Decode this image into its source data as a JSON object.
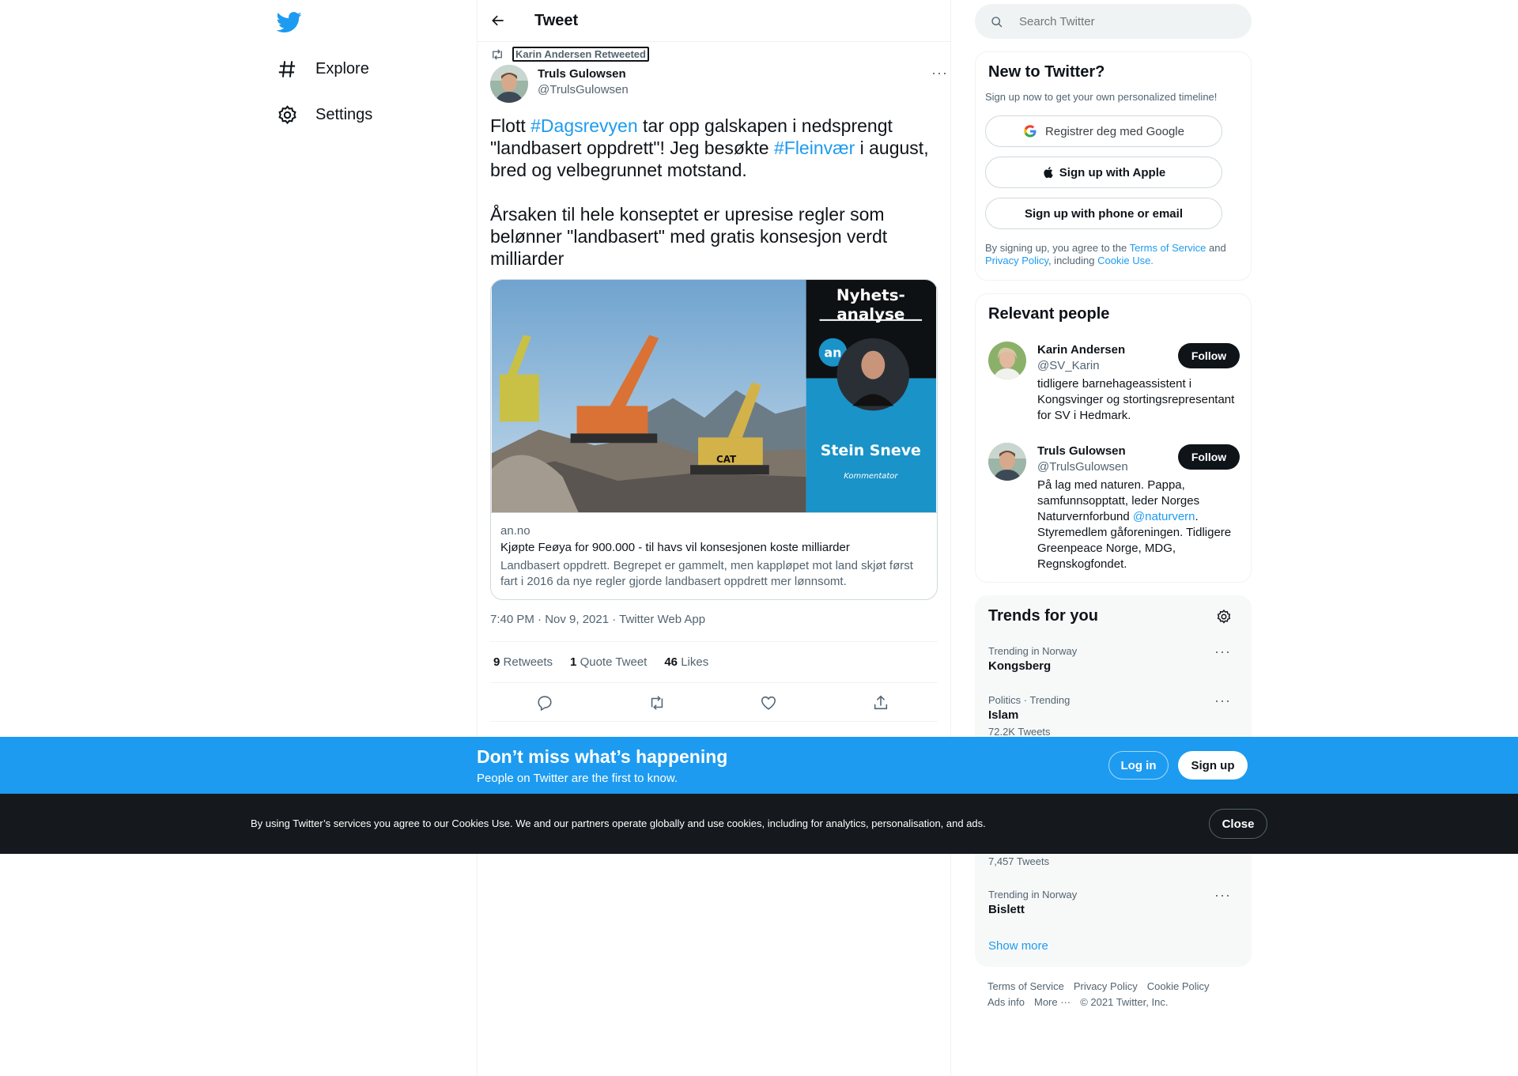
{
  "nav": {
    "items": [
      {
        "label": "Explore",
        "icon": "hashtag-icon"
      },
      {
        "label": "Settings",
        "icon": "gear-icon"
      }
    ]
  },
  "header": {
    "title": "Tweet"
  },
  "tweet": {
    "retweeted_by": "Karin Andersen Retweeted",
    "author_name": "Truls Gulowsen",
    "author_handle": "@TrulsGulowsen",
    "text_parts": {
      "p1": "Flott ",
      "h1": "#Dagsrevyen",
      "p2": " tar opp galskapen i nedsprengt \"landbasert oppdrett\"! Jeg besøkte ",
      "h2": "#Fleinvær",
      "p3": " i august, bred og velbegrunnet motstand.\n\nÅrsaken til hele konseptet er upresise regler som belønner \"landbasert\" med gratis konsesjon verdt milliarder"
    },
    "card": {
      "badge_line1": "Nyhets-",
      "badge_line2": "analyse",
      "logo_text": "an",
      "author_name": "Stein Sneve",
      "author_role": "Kommentator",
      "machine_label": "CAT",
      "domain": "an.no",
      "title": "Kjøpte Feøya for 900.000 - til havs vil konsesjonen koste milliarder",
      "description": "Landbasert oppdrett. Begrepet er gammelt, men kappløpet mot land skjøt først fart i 2016 da nye regler gjorde landbasert oppdrett mer lønnsomt."
    },
    "meta": "7:40 PM · Nov 9, 2021 · Twitter Web App",
    "stats": {
      "retweets_count": "9",
      "retweets_label": "Retweets",
      "quotes_count": "1",
      "quotes_label": "Quote Tweet",
      "likes_count": "46",
      "likes_label": "Likes"
    }
  },
  "search": {
    "placeholder": "Search Twitter"
  },
  "new_to_twitter": {
    "title": "New to Twitter?",
    "subtitle": "Sign up now to get your own personalized timeline!",
    "google_label": "Registrer deg med Google",
    "apple_label": "Sign up with Apple",
    "phone_label": "Sign up with phone or email",
    "terms_1": "By signing up, you agree to the ",
    "terms_link_1": "Terms of Service",
    "terms_2": " and ",
    "terms_link_2": "Privacy Policy",
    "terms_3": ", including ",
    "terms_link_3": "Cookie Use."
  },
  "relevant_people": {
    "title": "Relevant people",
    "follow_label": "Follow",
    "people": [
      {
        "name": "Karin Andersen",
        "handle": "@SV_Karin",
        "bio": "tidligere barnehageassistent i Kongsvinger og stortingsrepresentant for SV i Hedmark."
      },
      {
        "name": "Truls Gulowsen",
        "handle": "@TrulsGulowsen",
        "bio_1": "På lag med naturen. Pappa, samfunnsopptatt, leder Norges Naturvernforbund ",
        "bio_link": "@naturvern",
        "bio_2": ". Styremedlem gåforeningen. Tidligere Greenpeace Norge, MDG, Regnskogfondet."
      }
    ]
  },
  "trends": {
    "title": "Trends for you",
    "items": [
      {
        "context": "Trending in Norway",
        "name": "Kongsberg"
      },
      {
        "context": "Politics · Trending",
        "name": "Islam",
        "count": "72.2K Tweets"
      },
      {
        "count": "7,457 Tweets"
      },
      {
        "context": "Trending in Norway",
        "name": "Bislett"
      }
    ],
    "show_more": "Show more"
  },
  "footer": {
    "links": [
      "Terms of Service",
      "Privacy Policy",
      "Cookie Policy",
      "Ads info",
      "More ···"
    ],
    "copyright": "© 2021 Twitter, Inc."
  },
  "banner": {
    "title": "Don’t miss what’s happening",
    "subtitle": "People on Twitter are the first to know.",
    "login_label": "Log in",
    "signup_label": "Sign up"
  },
  "cookie": {
    "text": "By using Twitter’s services you agree to our Cookies Use. We and our partners operate globally and use cookies, including for analytics, personalisation, and ads.",
    "close_label": "Close"
  },
  "colors": {
    "accent": "#1d9bf0",
    "text": "#0f1419",
    "muted": "#536471",
    "cookie_bg": "#15181c"
  }
}
